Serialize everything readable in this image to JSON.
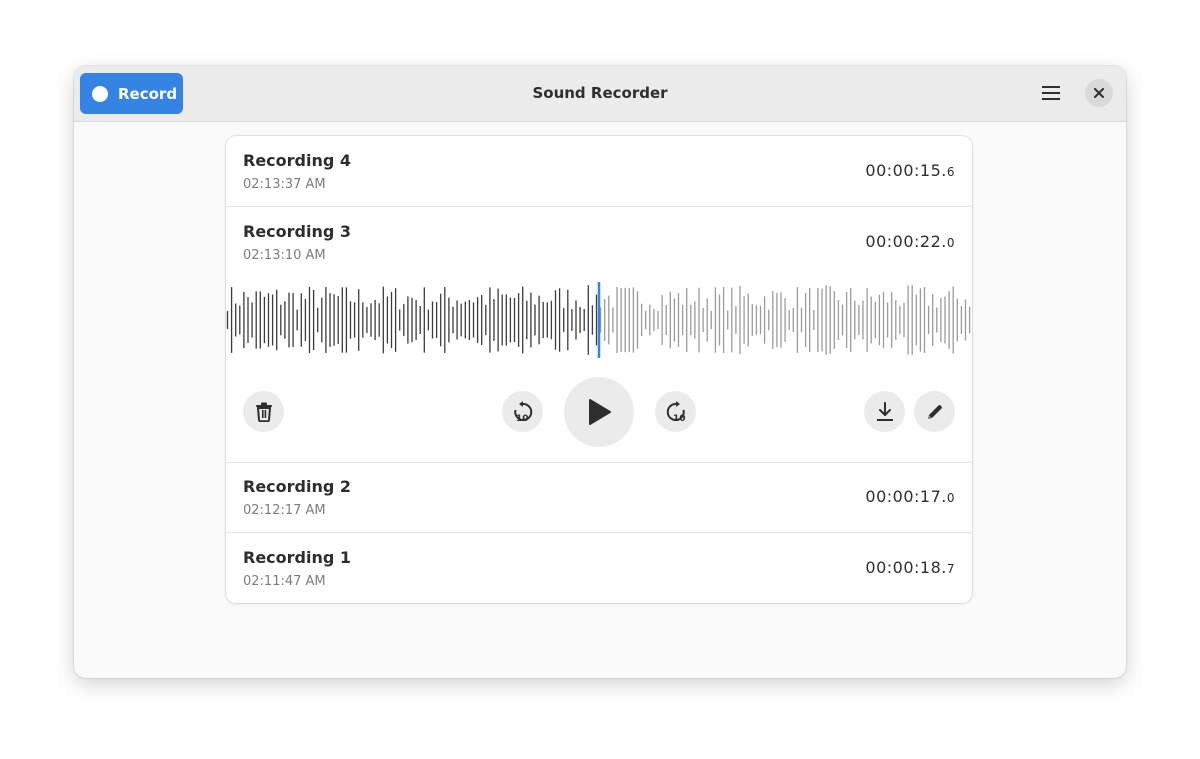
{
  "app": {
    "title": "Sound Recorder",
    "record_label": "Record",
    "accent_color": "#3584e4"
  },
  "recordings": [
    {
      "name": "Recording 4",
      "time": "02:13:37 AM",
      "duration_main": "00:00:15.",
      "duration_frac": "6"
    },
    {
      "name": "Recording 3",
      "time": "02:13:10 AM",
      "duration_main": "00:00:22.",
      "duration_frac": "0"
    },
    {
      "name": "Recording 2",
      "time": "02:12:17 AM",
      "duration_main": "00:00:17.",
      "duration_frac": "0"
    },
    {
      "name": "Recording 1",
      "time": "02:11:47 AM",
      "duration_main": "00:00:18.",
      "duration_frac": "7"
    }
  ],
  "player": {
    "expanded_recording": "Recording 3",
    "playhead_fraction": 0.5,
    "controls": [
      "delete-icon",
      "rewind-10-icon",
      "play-icon",
      "forward-10-icon",
      "export-icon",
      "rename-icon"
    ]
  }
}
